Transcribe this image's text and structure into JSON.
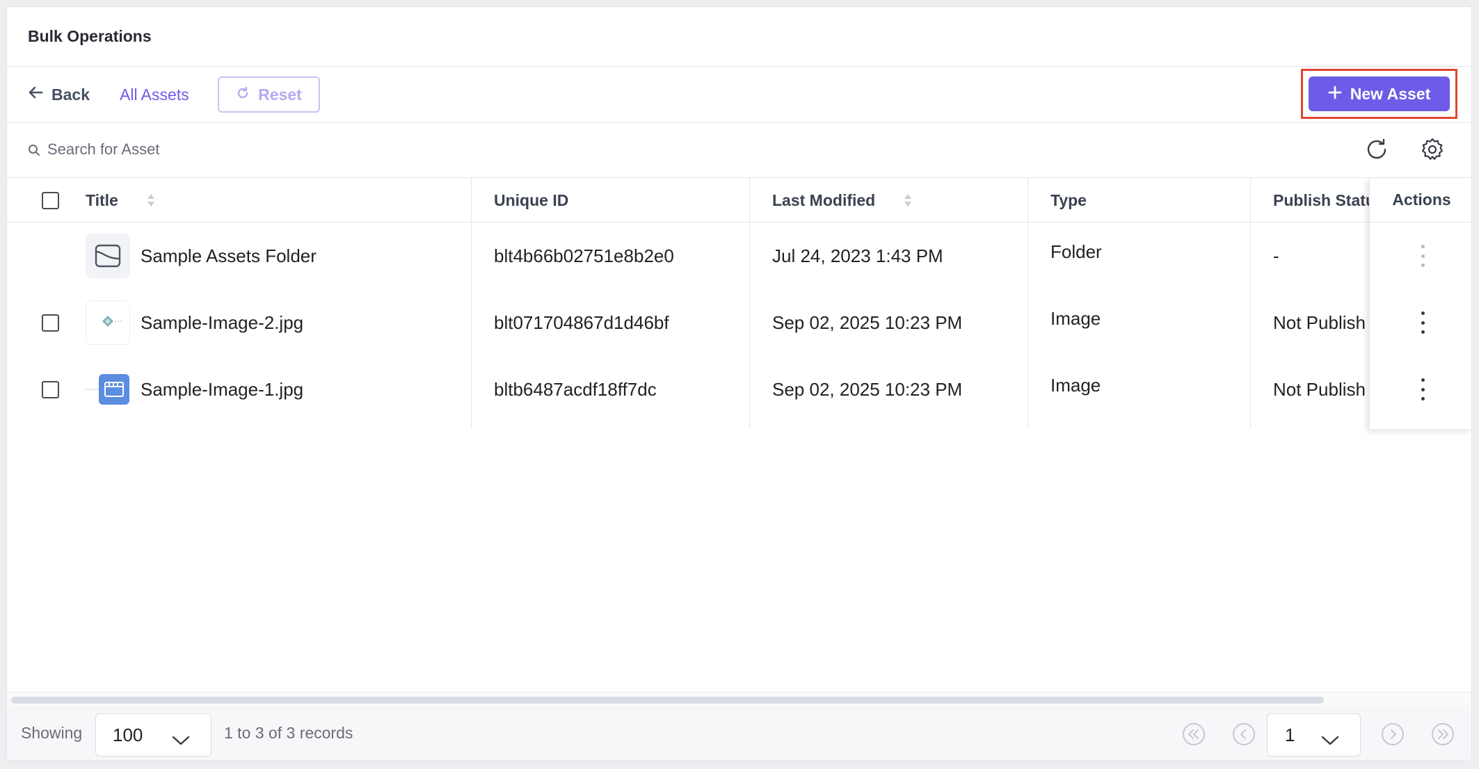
{
  "header": {
    "title": "Bulk Operations"
  },
  "toolbar": {
    "back_label": "Back",
    "all_assets_label": "All Assets",
    "reset_label": "Reset",
    "new_asset_label": "New Asset"
  },
  "search": {
    "placeholder": "Search for Asset"
  },
  "table": {
    "columns": {
      "title": "Title",
      "unique_id": "Unique ID",
      "last_modified": "Last Modified",
      "type": "Type",
      "publish_status": "Publish Statu",
      "actions": "Actions"
    },
    "rows": [
      {
        "title": "Sample Assets Folder",
        "unique_id": "blt4b66b02751e8b2e0",
        "last_modified": "Jul 24, 2023 1:43 PM",
        "type": "Folder",
        "publish_status": "-",
        "thumb": "folder-icon"
      },
      {
        "title": "Sample-Image-2.jpg",
        "unique_id": "blt071704867d1d46bf",
        "last_modified": "Sep 02, 2025 10:23 PM",
        "type": "Image",
        "publish_status": "Not Publish",
        "thumb": "image-thumbnail"
      },
      {
        "title": "Sample-Image-1.jpg",
        "unique_id": "bltb6487acdf18ff7dc",
        "last_modified": "Sep 02, 2025 10:23 PM",
        "type": "Image",
        "publish_status": "Not Publish",
        "thumb": "image-thumbnail"
      }
    ]
  },
  "footer": {
    "showing_label": "Showing",
    "page_size": "100",
    "records": "1 to 3 of 3 records",
    "current_page": "1"
  },
  "colors": {
    "accent": "#6c5ce7",
    "highlight_border": "#e0462f",
    "header_text": "#2a2a36"
  }
}
